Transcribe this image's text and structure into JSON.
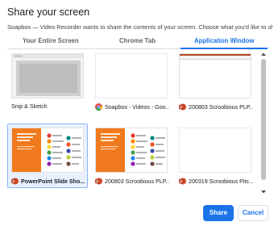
{
  "dialog": {
    "title": "Share your screen",
    "subtitle": "Soapbox — Video Recorder wants to share the contents of your screen. Choose what you'd like to share."
  },
  "tabs": [
    {
      "label": "Your Entire Screen",
      "active": false
    },
    {
      "label": "Chrome Tab",
      "active": false
    },
    {
      "label": "Application Window",
      "active": true
    }
  ],
  "windows": [
    {
      "label": "Snip & Sketch",
      "icon": "none",
      "thumb": "snip"
    },
    {
      "label": "Soapbox - Videos - Goo...",
      "icon": "chrome-icon",
      "thumb": "blank"
    },
    {
      "label": "200803 Scroobious PLP...",
      "icon": "powerpoint-icon",
      "thumb": "ppt-editor"
    },
    {
      "label": "PowerPoint Slide Sho...",
      "icon": "powerpoint-icon",
      "thumb": "slide",
      "selected": true
    },
    {
      "label": "200803 Scroobious PLP...",
      "icon": "powerpoint-icon",
      "thumb": "slide"
    },
    {
      "label": "200319 Scroobious Pitc...",
      "icon": "powerpoint-icon",
      "thumb": "blank"
    }
  ],
  "thumb_text": {
    "slide_title": "How to Slide Your Pitch",
    "slide_subtitle": "Make it memorable and concise"
  },
  "buttons": {
    "share": "Share",
    "cancel": "Cancel"
  },
  "colors": {
    "accent": "#1a73e8",
    "slide_orange": "#f07a1d",
    "powerpoint": "#d24726"
  }
}
